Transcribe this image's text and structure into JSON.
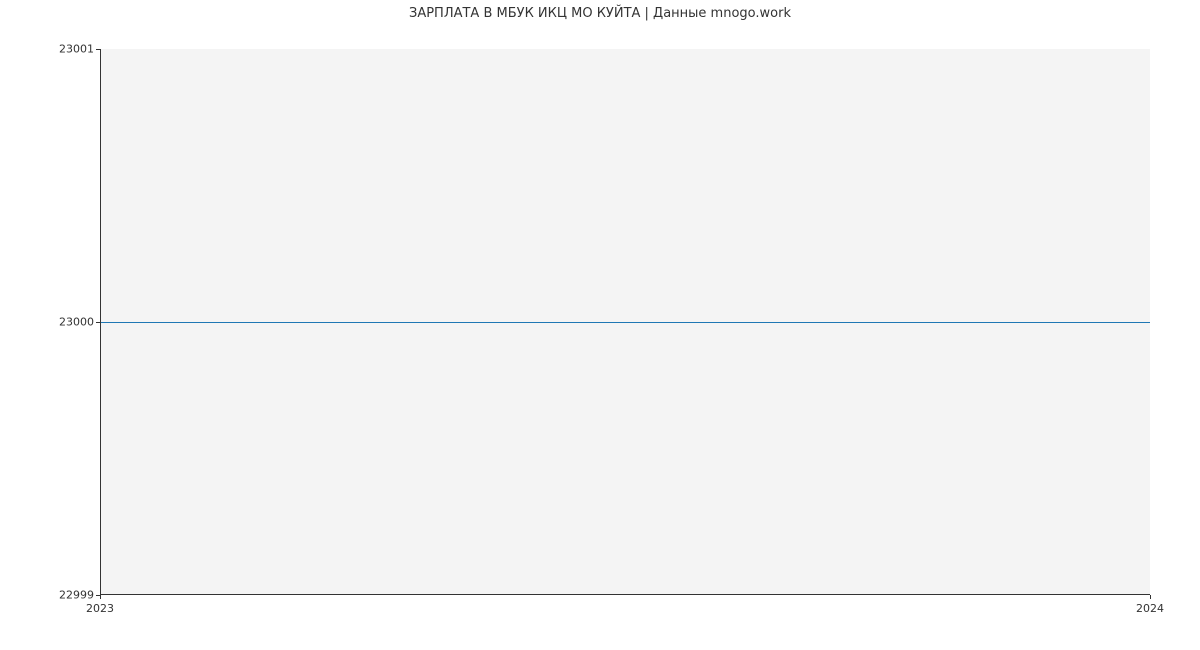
{
  "chart_data": {
    "type": "line",
    "title": "ЗАРПЛАТА В МБУК ИКЦ МО КУЙТА | Данные mnogo.work",
    "xlabel": "",
    "ylabel": "",
    "x_ticks": [
      "2023",
      "2024"
    ],
    "y_ticks": [
      22999,
      23000,
      23001
    ],
    "ylim": [
      22999,
      23001
    ],
    "x": [
      "2023",
      "2024"
    ],
    "values": [
      23000,
      23000
    ],
    "line_color": "#1f77b4"
  }
}
